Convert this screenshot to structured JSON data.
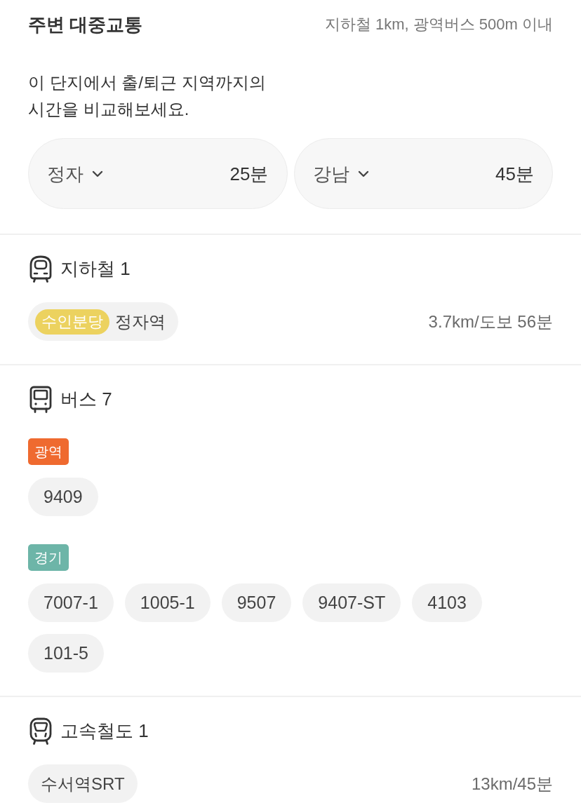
{
  "header": {
    "title": "주변 대중교통",
    "note": "지하철 1km, 광역버스 500m 이내"
  },
  "intro": "이 단지에서 출/퇴근 지역까지의\n시간을 비교해보세요.",
  "commutes": [
    {
      "place": "정자",
      "time": "25분"
    },
    {
      "place": "강남",
      "time": "45분"
    }
  ],
  "sections": [
    {
      "kind": "subway",
      "title": "지하철 1",
      "stations": [
        {
          "line": {
            "label": "수인분당",
            "color": "#ecd25f"
          },
          "name": "정자역",
          "distance": "3.7km/도보 56분"
        }
      ]
    },
    {
      "kind": "bus",
      "title": "버스 7",
      "route_groups": [
        {
          "tag": {
            "label": "광역",
            "color": "#ef6a2f"
          },
          "routes": [
            "9409"
          ]
        },
        {
          "tag": {
            "label": "경기",
            "color": "#6db5a8"
          },
          "routes": [
            "7007-1",
            "1005-1",
            "9507",
            "9407-ST",
            "4103",
            "101-5"
          ]
        }
      ]
    },
    {
      "kind": "rail",
      "title": "고속철도 1",
      "stations": [
        {
          "name": "수서역SRT",
          "distance": "13km/45분"
        }
      ]
    }
  ]
}
